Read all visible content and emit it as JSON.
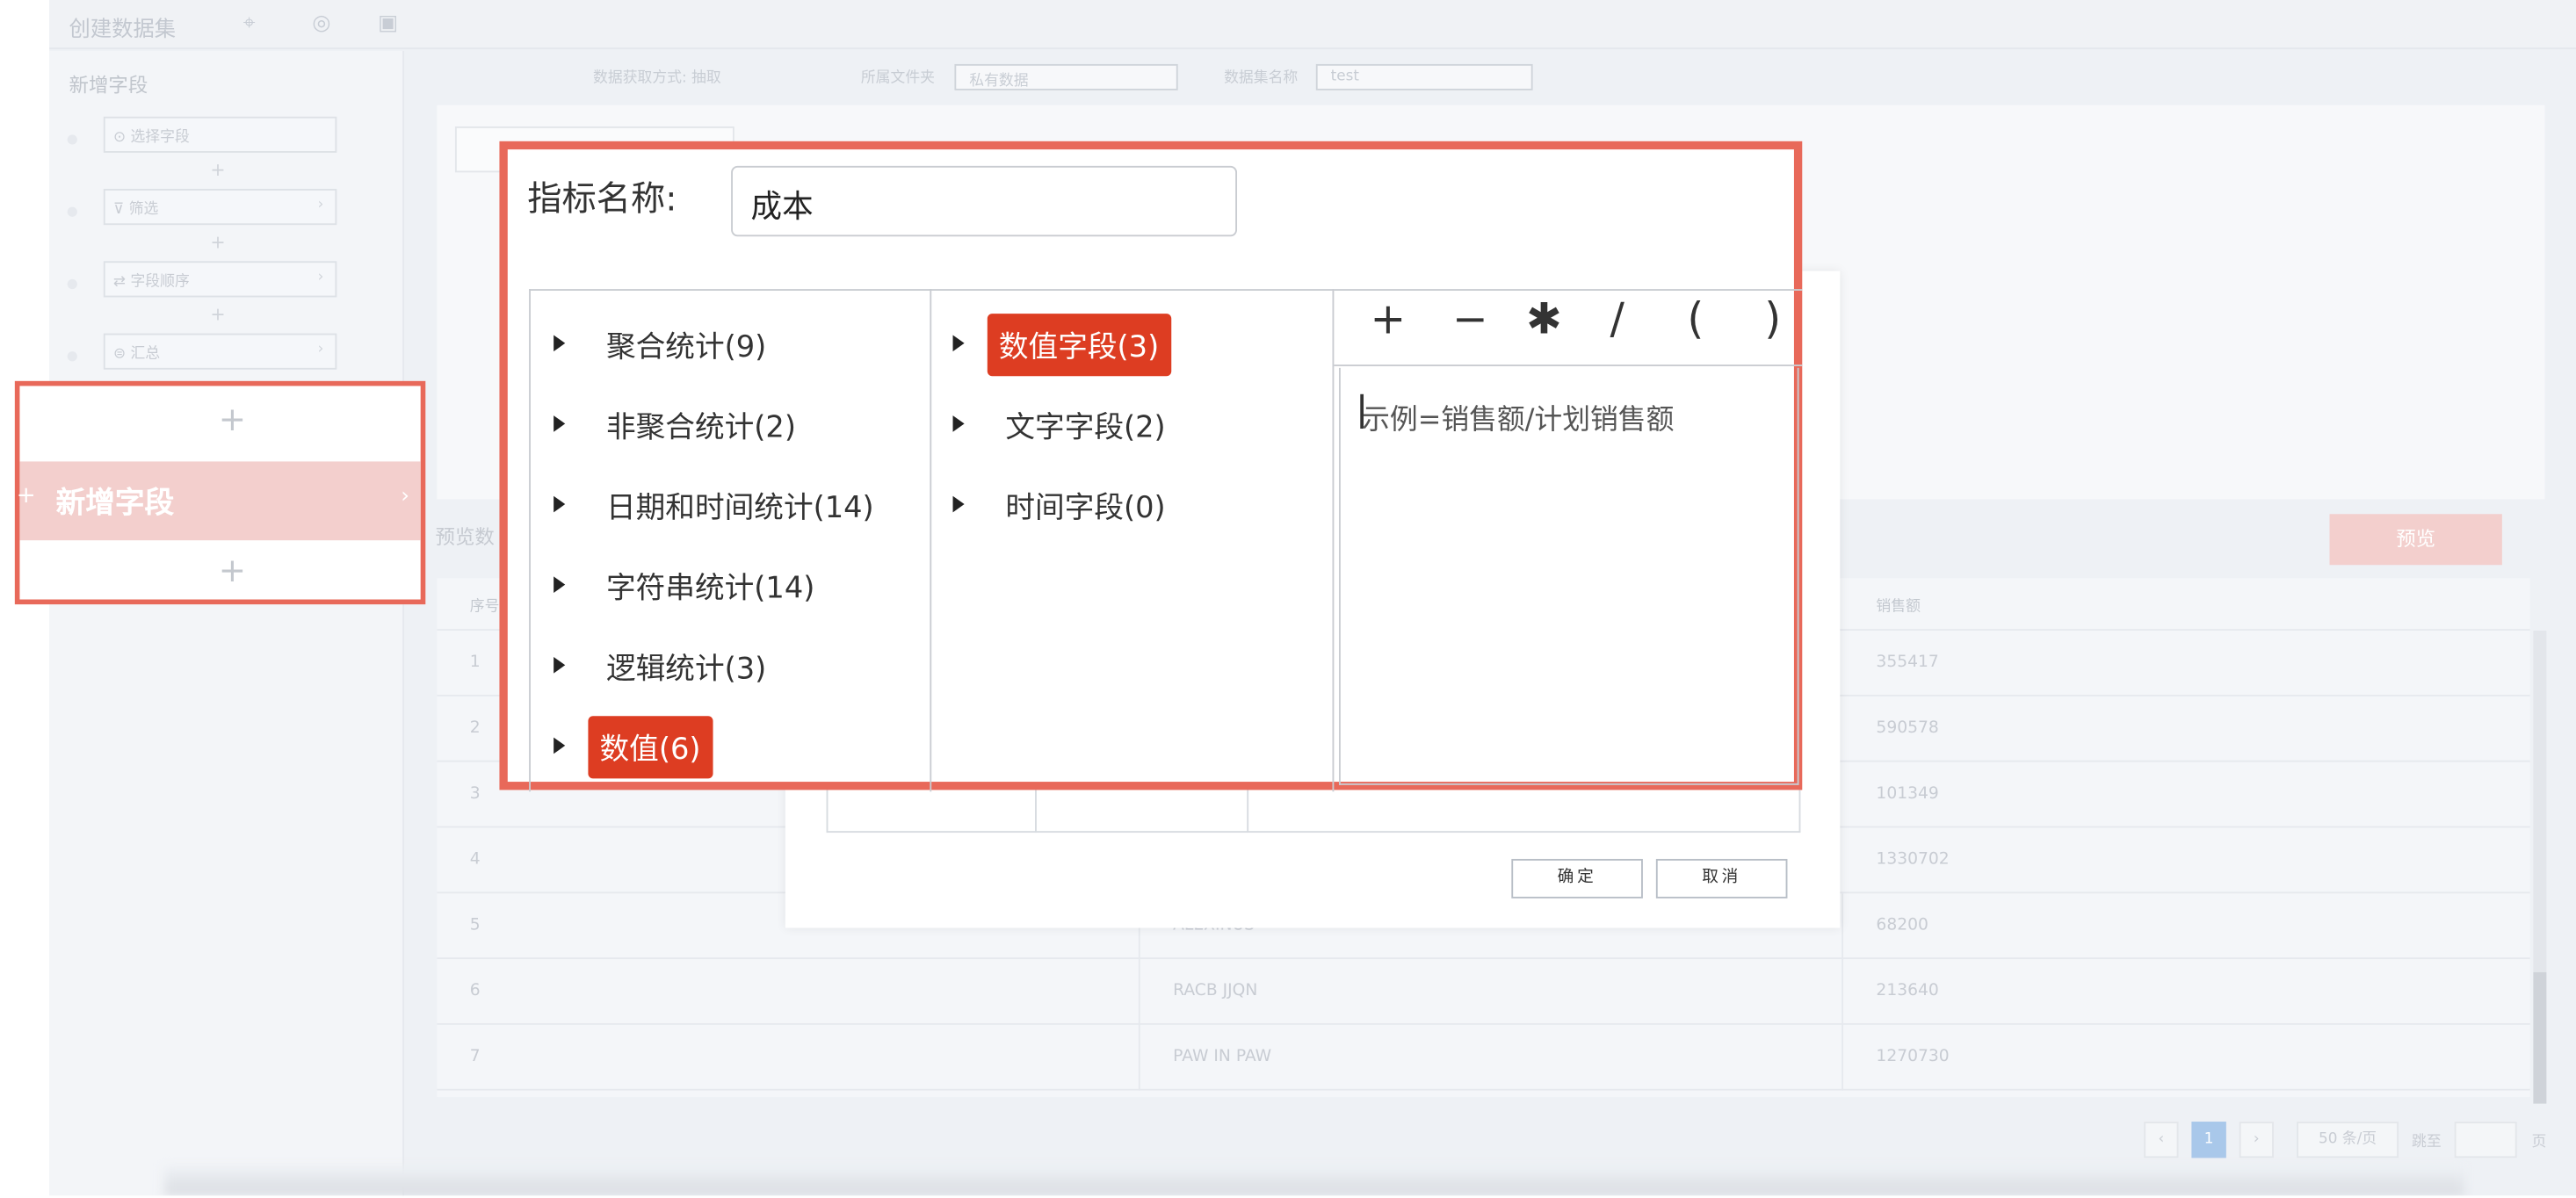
{
  "app": {
    "title": "创建数据集"
  },
  "left_panel": {
    "title": "新增字段",
    "steps": [
      {
        "label": "选择字段"
      },
      {
        "label": "筛选"
      },
      {
        "label": "字段顺序"
      },
      {
        "label": "汇总"
      }
    ],
    "new_field_label": "新增字段"
  },
  "top_form": {
    "method_label": "数据获取方式: 抽取",
    "folder_label": "所属文件夹",
    "folder_value": "私有数据",
    "dataset_name_label": "数据集名称",
    "dataset_name_value": "test"
  },
  "preview": {
    "label": "预览数",
    "button": "预览",
    "columns": [
      "序号",
      "销售额"
    ],
    "rows": [
      {
        "idx": "1",
        "name": "",
        "sales": "355417"
      },
      {
        "idx": "2",
        "name": "",
        "sales": "590578"
      },
      {
        "idx": "3",
        "name": "",
        "sales": "101349"
      },
      {
        "idx": "4",
        "name": "",
        "sales": "1330702"
      },
      {
        "idx": "5",
        "name": "ALEXINUS",
        "sales": "68200"
      },
      {
        "idx": "6",
        "name": "RACB JJQN",
        "sales": "213640"
      },
      {
        "idx": "7",
        "name": "PAW IN PAW",
        "sales": "1270730"
      }
    ],
    "pagination": {
      "current": "1",
      "page_size": "50 条/页",
      "goto_label": "跳至",
      "page_unit": "页"
    }
  },
  "dialog": {
    "name_label": "指标名称:",
    "name_value": "成本",
    "functions": [
      {
        "label": "聚合统计(9)",
        "active": false
      },
      {
        "label": "非聚合统计(2)",
        "active": false
      },
      {
        "label": "日期和时间统计(14)",
        "active": false
      },
      {
        "label": "字符串统计(14)",
        "active": false
      },
      {
        "label": "逻辑统计(3)",
        "active": false
      },
      {
        "label": "数值(6)",
        "active": true
      }
    ],
    "fields": [
      {
        "label": "数值字段(3)",
        "active": true
      },
      {
        "label": "文字字段(2)",
        "active": false
      },
      {
        "label": "时间字段(0)",
        "active": false
      }
    ],
    "operators": [
      "+",
      "−",
      "✱",
      "/",
      "(",
      ")"
    ],
    "formula_placeholder": "示例=销售额/计划销售额",
    "confirm": "确定",
    "cancel": "取消"
  },
  "colors": {
    "accent": "#dd3d22",
    "callout_border": "#e8695a"
  }
}
